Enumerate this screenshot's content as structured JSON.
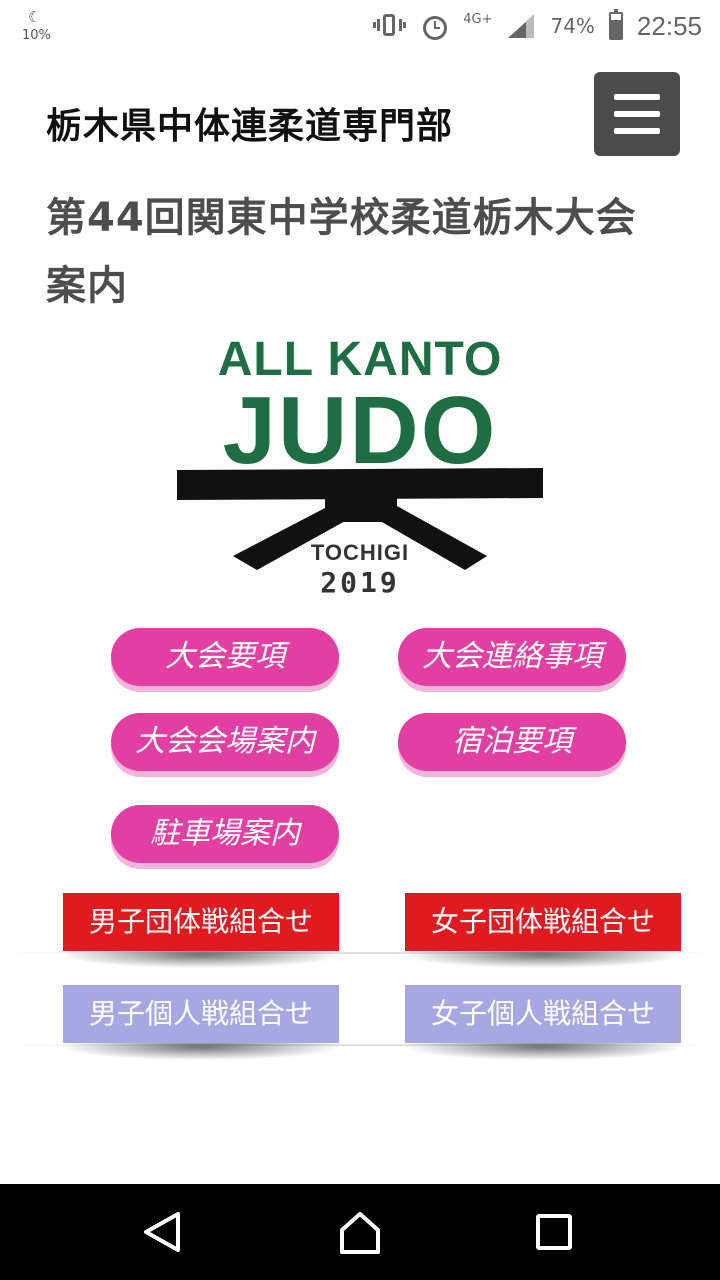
{
  "status_bar": {
    "battery_saver": "10%",
    "network": "4G+",
    "battery": "74%",
    "time": "22:55",
    "battery_level": 0.74
  },
  "header": {
    "site_title": "栃木県中体連柔道専門部",
    "menu_icon": "hamburger-menu-icon"
  },
  "page": {
    "title": "第44回関東中学校柔道栃木大会案内"
  },
  "logo": {
    "line1": "ALL KANTO",
    "line2": "JUDO",
    "city": "TOCHIGI",
    "year": "2019",
    "text_color": "#1f6e43"
  },
  "buttons": {
    "pink": [
      "大会要項",
      "大会連絡事項",
      "大会会場案内",
      "宿泊要項",
      "駐車場案内"
    ],
    "team": [
      "男子団体戦組合せ",
      "女子団体戦組合せ"
    ],
    "individual": [
      "男子個人戦組合せ",
      "女子個人戦組合せ"
    ]
  },
  "colors": {
    "pink": "#e33fa2",
    "red": "#e11a1f",
    "lavender": "#a6a7e3",
    "menu_bg": "#4b4b4b"
  },
  "nav_bar": {
    "icons": [
      "back-icon",
      "home-icon",
      "recents-icon"
    ]
  }
}
